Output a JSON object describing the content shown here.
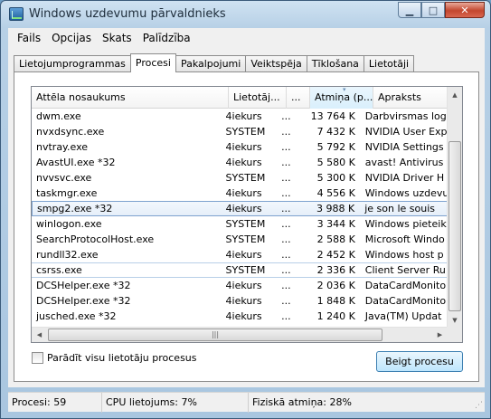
{
  "window": {
    "title": "Windows uzdevumu pārvaldnieks"
  },
  "menu": [
    "Fails",
    "Opcijas",
    "Skats",
    "Palīdzība"
  ],
  "tabs": [
    {
      "label": "Lietojumprogrammas",
      "active": false
    },
    {
      "label": "Procesi",
      "active": true
    },
    {
      "label": "Pakalpojumi",
      "active": false
    },
    {
      "label": "Veiktspēja",
      "active": false
    },
    {
      "label": "Tīklošana",
      "active": false
    },
    {
      "label": "Lietotāji",
      "active": false
    }
  ],
  "columns": [
    "Attēla nosaukums",
    "Lietotāj...",
    "...",
    "Atmiņa (p...",
    "Apraksts"
  ],
  "processes": [
    {
      "name": "dwm.exe",
      "user": "4iekurs",
      "cpu": "...",
      "memory": "13 764 K",
      "description": "Darbvirsmas logu"
    },
    {
      "name": "nvxdsync.exe",
      "user": "SYSTEM",
      "cpu": "...",
      "memory": "7 432 K",
      "description": "NVIDIA User Exp"
    },
    {
      "name": "nvtray.exe",
      "user": "4iekurs",
      "cpu": "...",
      "memory": "5 792 K",
      "description": "NVIDIA Settings"
    },
    {
      "name": "AvastUI.exe *32",
      "user": "4iekurs",
      "cpu": "...",
      "memory": "5 580 K",
      "description": "avast! Antivirus"
    },
    {
      "name": "nvvsvc.exe",
      "user": "SYSTEM",
      "cpu": "...",
      "memory": "5 300 K",
      "description": "NVIDIA Driver H"
    },
    {
      "name": "taskmgr.exe",
      "user": "4iekurs",
      "cpu": "...",
      "memory": "4 556 K",
      "description": "Windows uzdevu"
    },
    {
      "name": "smpg2.exe *32",
      "user": "4iekurs",
      "cpu": "...",
      "memory": "3 988 K",
      "description": "je son le souis",
      "selected": true
    },
    {
      "name": "winlogon.exe",
      "user": "SYSTEM",
      "cpu": "...",
      "memory": "3 344 K",
      "description": "Windows pieteik"
    },
    {
      "name": "SearchProtocolHost.exe",
      "user": "SYSTEM",
      "cpu": "...",
      "memory": "2 588 K",
      "description": "Microsoft Windo"
    },
    {
      "name": "rundll32.exe",
      "user": "4iekurs",
      "cpu": "...",
      "memory": "2 452 K",
      "description": "Windows host p"
    },
    {
      "name": "csrss.exe",
      "user": "SYSTEM",
      "cpu": "...",
      "memory": "2 336 K",
      "description": "Client Server Ru",
      "focus": true
    },
    {
      "name": "DCSHelper.exe *32",
      "user": "4iekurs",
      "cpu": "...",
      "memory": "2 036 K",
      "description": "DataCardMonito"
    },
    {
      "name": "DCSHelper.exe *32",
      "user": "4iekurs",
      "cpu": "...",
      "memory": "1 848 K",
      "description": "DataCardMonito"
    },
    {
      "name": "jusched.exe *32",
      "user": "4iekurs",
      "cpu": "...",
      "memory": "1 240 K",
      "description": "Java(TM) Updat"
    }
  ],
  "show_all_label": "Parādīt visu lietotāju procesus",
  "end_process_label": "Beigt procesu",
  "status": {
    "processes": "Procesi: 59",
    "cpu": "CPU lietojums: 7%",
    "memory": "Fiziskā atmiņa: 28%"
  }
}
